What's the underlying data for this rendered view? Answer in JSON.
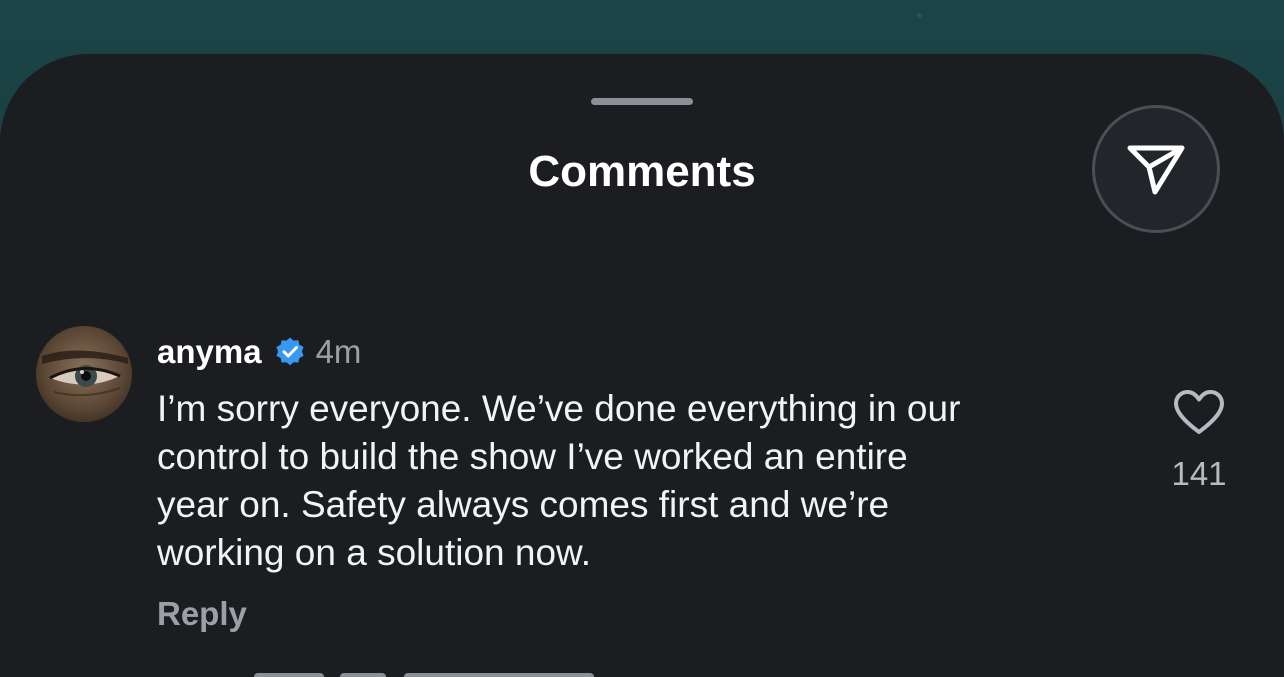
{
  "sheet": {
    "title": "Comments",
    "share_icon": "paper-plane-icon"
  },
  "comment": {
    "username": "anyma",
    "verified_icon": "verified-badge-icon",
    "verified_color": "#3897f0",
    "timestamp": "4m",
    "text": "I’m sorry everyone. We’ve done everything in our\ncontrol to build the show I’ve worked an entire\nyear on. Safety always comes first and we’re\nworking on a solution now.",
    "reply_label": "Reply",
    "like_icon": "heart-outline-icon",
    "like_count": "141"
  },
  "colors": {
    "sheet_background": "#1b1d20",
    "backdrop": "#163a3c",
    "secondary_text": "#9aa0a6"
  }
}
